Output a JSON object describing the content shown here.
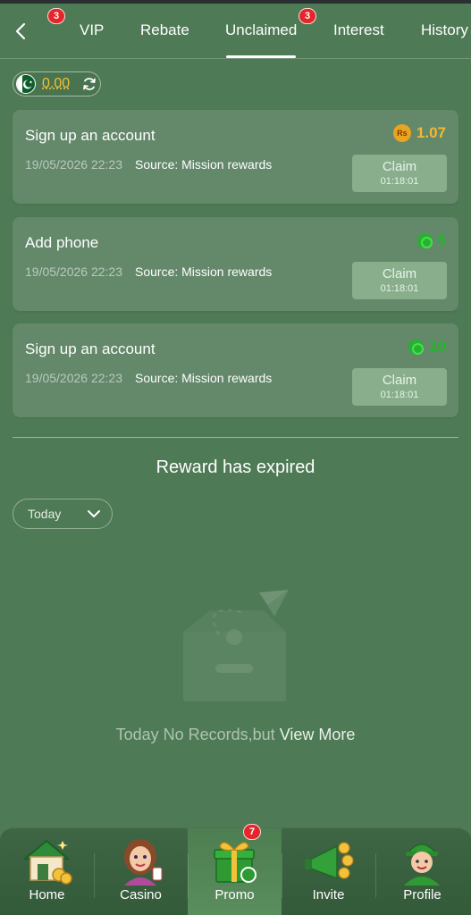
{
  "header": {
    "tabs": [
      {
        "label": "VIP"
      },
      {
        "label": "Rebate"
      },
      {
        "label": "Unclaimed",
        "active": true
      },
      {
        "label": "Interest"
      },
      {
        "label": "History"
      }
    ],
    "badge_first": "3",
    "badge_unclaimed": "3"
  },
  "balance": {
    "value": "0.00",
    "flag_icon": "pakistan-flag-icon",
    "color": "#f0c23a"
  },
  "rewards": [
    {
      "title": "Sign up an account",
      "date": "19/05/2026 22:23",
      "source": "Source: Mission rewards",
      "amount": "1.07",
      "currency_icon": "rupee-coin-icon",
      "claim_label": "Claim",
      "timer": "01:18:01"
    },
    {
      "title": "Add phone",
      "date": "19/05/2026 22:23",
      "source": "Source: Mission rewards",
      "amount": "5",
      "currency_icon": "green-chip-icon",
      "claim_label": "Claim",
      "timer": "01:18:01"
    },
    {
      "title": "Sign up an account",
      "date": "19/05/2026 22:23",
      "source": "Source: Mission rewards",
      "amount": "10",
      "currency_icon": "green-chip-icon",
      "claim_label": "Claim",
      "timer": "01:18:01"
    }
  ],
  "expired": {
    "title": "Reward has expired",
    "filter_value": "Today",
    "empty_text": "Today No Records,but",
    "empty_link": "View More"
  },
  "nav": {
    "items": [
      {
        "label": "Home",
        "icon": "home-icon"
      },
      {
        "label": "Casino",
        "icon": "casino-icon"
      },
      {
        "label": "Promo",
        "icon": "gift-icon",
        "active": true
      },
      {
        "label": "Invite",
        "icon": "megaphone-icon"
      },
      {
        "label": "Profile",
        "icon": "profile-icon"
      }
    ],
    "promo_badge": "7"
  },
  "colors": {
    "background": "#4e7a55",
    "card": "#63886a",
    "claim_button": "#88ae8c",
    "gold": "#f4b833",
    "green_amount": "#1fb72a",
    "badge": "#e4262b"
  }
}
